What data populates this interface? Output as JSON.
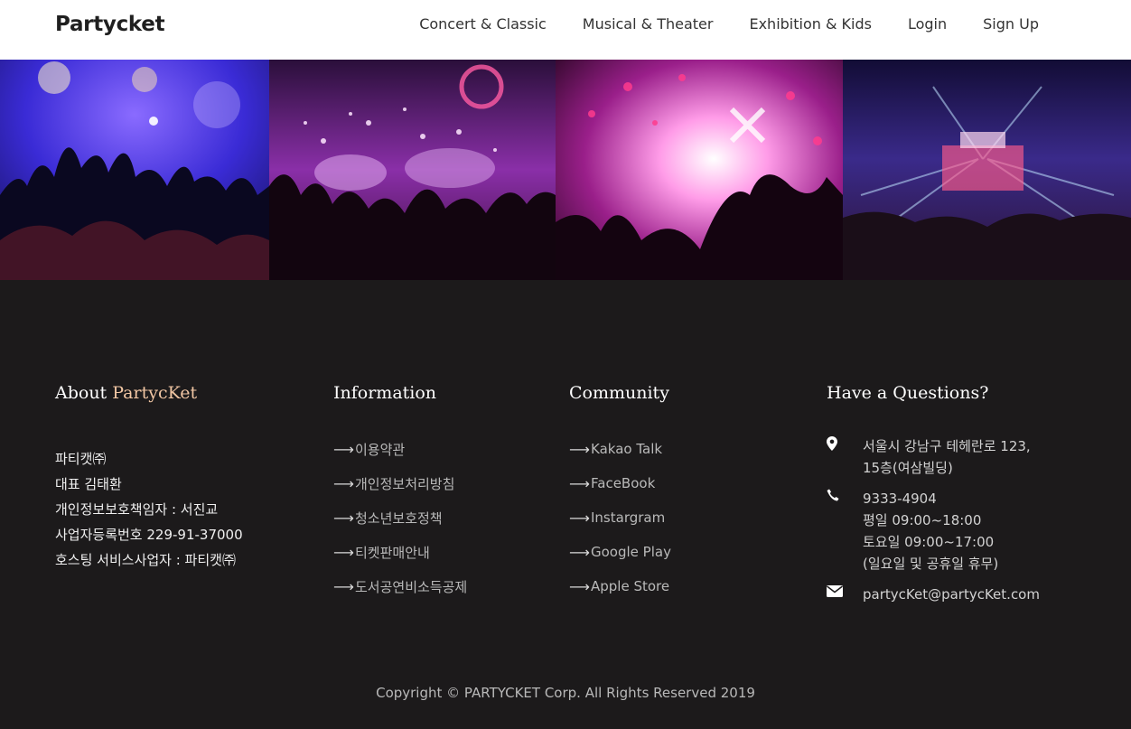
{
  "brand": "Partycket",
  "nav": {
    "items": [
      "Concert & Classic",
      "Musical & Theater",
      "Exhibition & Kids",
      "Login",
      "Sign Up"
    ]
  },
  "footer": {
    "about": {
      "title_main": "About ",
      "title_accent": "PartycKet",
      "lines": [
        "파티캣㈜",
        "대표 김태환",
        "개인정보보호책임자 : 서진교",
        "사업자등록번호 229-91-37000",
        "호스팅 서비스사업자 : 파티캣㈜"
      ]
    },
    "information": {
      "title": "Information",
      "links": [
        "이용약관",
        "개인정보처리방침",
        "청소년보호정책",
        "티켓판매안내",
        "도서공연비소득공제"
      ]
    },
    "community": {
      "title": "Community",
      "links": [
        "Kakao Talk",
        "FaceBook",
        "Instargram",
        "Google Play",
        "Apple Store"
      ]
    },
    "questions": {
      "title": "Have a Questions?",
      "address": [
        "서울시 강남구 테헤란로 123,",
        "15층(여삼빌딩)"
      ],
      "phone": [
        "9333-4904",
        "평일 09:00~18:00",
        "토요일 09:00~17:00",
        "(일요일 및 공휴일 휴무)"
      ],
      "email": "partycKet@partycKet.com"
    },
    "copyright": "Copyright © PARTYCKET Corp. All Rights Reserved 2019"
  }
}
